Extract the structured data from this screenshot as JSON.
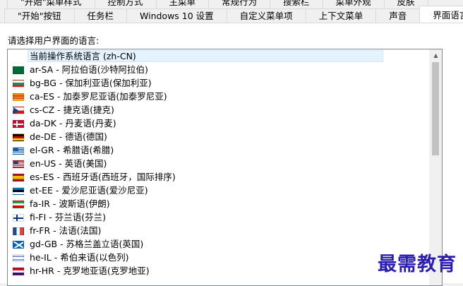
{
  "tabs_back": [
    "\"开始\"菜单样式",
    "控制方式",
    "主菜单",
    "常规行为",
    "搜索栏",
    "菜单外观",
    "皮肤"
  ],
  "tabs_front": [
    "\"开始\"按钮",
    "任务栏",
    "Windows 10 设置",
    "自定义菜单项",
    "上下文菜单",
    "声音",
    "界面语言"
  ],
  "active_tab_index": 6,
  "prompt": "请选择用户界面的语言:",
  "languages": [
    {
      "label": "当前操作系统语言 (zh-CN)",
      "flag": "none",
      "selected": true
    },
    {
      "label": "ar-SA - 阿拉伯语(沙特阿拉伯)",
      "flag": "sa"
    },
    {
      "label": "bg-BG - 保加利亚语(保加利亚)",
      "flag": "bg"
    },
    {
      "label": "ca-ES - 加泰罗尼亚语(加泰罗尼亚)",
      "flag": "ca"
    },
    {
      "label": "cs-CZ - 捷克语(捷克)",
      "flag": "cz"
    },
    {
      "label": "da-DK - 丹麦语(丹麦)",
      "flag": "dk"
    },
    {
      "label": "de-DE - 德语(德国)",
      "flag": "de"
    },
    {
      "label": "el-GR - 希腊语(希腊)",
      "flag": "gr"
    },
    {
      "label": "en-US - 英语(美国)",
      "flag": "us"
    },
    {
      "label": "es-ES - 西班牙语(西班牙，国际排序)",
      "flag": "es"
    },
    {
      "label": "et-EE - 爱沙尼亚语(爱沙尼亚)",
      "flag": "ee"
    },
    {
      "label": "fa-IR - 波斯语(伊朗)",
      "flag": "ir"
    },
    {
      "label": "fi-FI - 芬兰语(芬兰)",
      "flag": "fi"
    },
    {
      "label": "fr-FR - 法语(法国)",
      "flag": "fr"
    },
    {
      "label": "gd-GB - 苏格兰盖立语(英国)",
      "flag": "gb"
    },
    {
      "label": "he-IL - 希伯来语(以色列)",
      "flag": "il"
    },
    {
      "label": "hr-HR - 克罗地亚语(克罗地亚)",
      "flag": "hr"
    }
  ],
  "watermark": "最需教育"
}
